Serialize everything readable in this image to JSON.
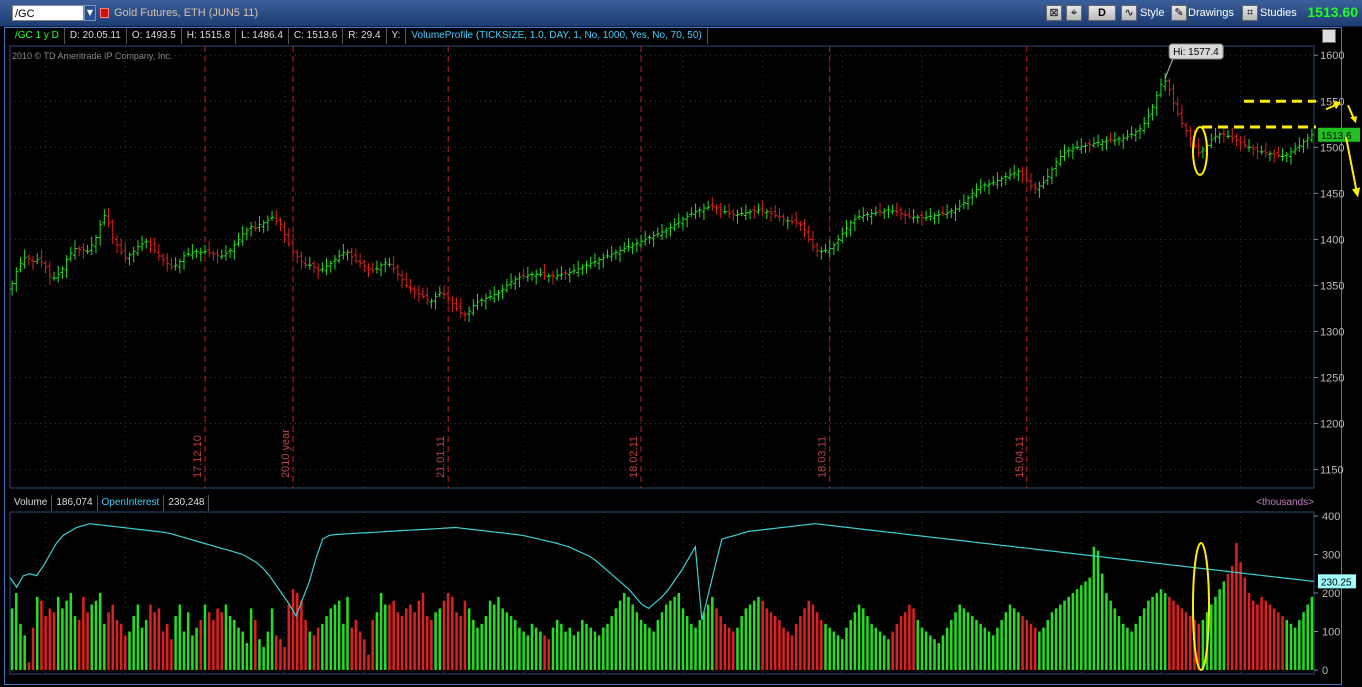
{
  "toolbar": {
    "symbol": "/GC",
    "description": "Gold Futures, ETH (JUN5 11)",
    "aggregation": "D",
    "style_label": "Style",
    "drawings_label": "Drawings",
    "studies_label": "Studies",
    "last_price": "1513.60"
  },
  "infobar": {
    "period": "/GC 1 y D",
    "date": "D: 20.05.11",
    "open": "O: 1493.5",
    "high": "H: 1515.8",
    "low": "L: 1486.4",
    "close": "C: 1513.6",
    "range": "R: 29.4",
    "y": "Y:",
    "study": "VolumeProfile (TICKSIZE, 1.0, DAY, 1, No, 1000, Yes, No, 70, 50)"
  },
  "copyright": "2010 © TD Ameritrade IP Company, Inc.",
  "volume_bar": {
    "volume_label": "Volume",
    "volume_value": "186,074",
    "oi_label": "OpenInterest",
    "oi_value": "230,248",
    "units": "<thousands>"
  },
  "colors": {
    "up": "#20e020",
    "down": "#e02020",
    "oi_line": "#40d0d0",
    "annotation": "#ffee00",
    "separator": "#c02020"
  },
  "chart_data": [
    {
      "type": "ohlc",
      "price_axis": {
        "ylim": [
          1130,
          1610
        ],
        "ticks": [
          1150,
          1200,
          1250,
          1300,
          1350,
          1400,
          1450,
          1500,
          1550,
          1600
        ]
      },
      "high_label": "Hi: 1577.4",
      "high_value": 1577.4,
      "current_label": "1513.6",
      "current_value": 1513.6,
      "annotation_levels": [
        1550,
        1522
      ],
      "separators": [
        {
          "label": "17.12.10",
          "index": 46
        },
        {
          "label": "2010 year",
          "index": 67
        },
        {
          "label": "21.01.11",
          "index": 104
        },
        {
          "label": "18.02.11",
          "index": 150
        },
        {
          "label": "18.03.11",
          "index": 195
        },
        {
          "label": "15.04.11",
          "index": 242
        }
      ],
      "closes": [
        1352,
        1365,
        1374,
        1380,
        1379,
        1376,
        1378,
        1375,
        1370,
        1360,
        1358,
        1362,
        1368,
        1378,
        1385,
        1390,
        1389,
        1388,
        1387,
        1394,
        1402,
        1416,
        1426,
        1418,
        1402,
        1394,
        1386,
        1380,
        1383,
        1387,
        1392,
        1395,
        1398,
        1394,
        1388,
        1382,
        1378,
        1374,
        1370,
        1372,
        1376,
        1382,
        1384,
        1386,
        1387,
        1386,
        1387,
        1386,
        1384,
        1383,
        1382,
        1385,
        1388,
        1394,
        1400,
        1406,
        1410,
        1414,
        1412,
        1416,
        1418,
        1421,
        1424,
        1420,
        1416,
        1405,
        1395,
        1387,
        1381,
        1376,
        1372,
        1372,
        1370,
        1366,
        1368,
        1371,
        1374,
        1378,
        1382,
        1386,
        1386,
        1381,
        1377,
        1374,
        1371,
        1368,
        1366,
        1368,
        1372,
        1375,
        1373,
        1368,
        1362,
        1356,
        1350,
        1346,
        1343,
        1341,
        1338,
        1334,
        1333,
        1338,
        1342,
        1340,
        1336,
        1330,
        1325,
        1320,
        1318,
        1322,
        1328,
        1332,
        1334,
        1336,
        1338,
        1340,
        1342,
        1346,
        1350,
        1354,
        1357,
        1359,
        1360,
        1361,
        1362,
        1362,
        1362,
        1361,
        1360,
        1360,
        1361,
        1362,
        1363,
        1364,
        1366,
        1368,
        1370,
        1372,
        1374,
        1376,
        1378,
        1380,
        1382,
        1384,
        1386,
        1388,
        1390,
        1392,
        1394,
        1396,
        1398,
        1400,
        1402,
        1404,
        1406,
        1408,
        1410,
        1413,
        1416,
        1419,
        1422,
        1425,
        1428,
        1430,
        1432,
        1434,
        1435,
        1436,
        1434,
        1432,
        1430,
        1428,
        1427,
        1427,
        1428,
        1429,
        1430,
        1431,
        1432,
        1431,
        1430,
        1428,
        1426,
        1424,
        1422,
        1420,
        1419,
        1418,
        1416,
        1410,
        1400,
        1392,
        1388,
        1387,
        1388,
        1390,
        1394,
        1400,
        1406,
        1412,
        1418,
        1422,
        1425,
        1426,
        1427,
        1428,
        1429,
        1430,
        1431,
        1432,
        1431,
        1430,
        1428,
        1426,
        1425,
        1424,
        1424,
        1424,
        1424,
        1425,
        1426,
        1427,
        1428,
        1429,
        1431,
        1433,
        1436,
        1440,
        1445,
        1450,
        1454,
        1457,
        1459,
        1460,
        1462,
        1464,
        1466,
        1468,
        1470,
        1472,
        1474,
        1470,
        1464,
        1458,
        1456,
        1458,
        1462,
        1468,
        1476,
        1484,
        1490,
        1494,
        1497,
        1499,
        1500,
        1501,
        1502,
        1503,
        1504,
        1505,
        1506,
        1507,
        1508,
        1508,
        1509,
        1510,
        1512,
        1514,
        1517,
        1520,
        1526,
        1534,
        1544,
        1556,
        1568,
        1572,
        1562,
        1548,
        1536,
        1526,
        1518,
        1510,
        1502,
        1494,
        1498,
        1502,
        1508,
        1512,
        1514,
        1514,
        1512,
        1510,
        1508,
        1505,
        1502,
        1500,
        1498,
        1496,
        1495,
        1494,
        1493,
        1492,
        1491,
        1490,
        1492,
        1495,
        1498,
        1502,
        1506,
        1510,
        1513.6
      ],
      "volume_axis": {
        "ylim": [
          0,
          400
        ],
        "ticks": [
          0,
          100,
          200,
          300,
          400
        ]
      },
      "oi_current_label": "230.25",
      "oi_current_value": 230.25,
      "volume": [
        160,
        200,
        120,
        90,
        20,
        110,
        190,
        180,
        140,
        160,
        150,
        190,
        160,
        180,
        200,
        140,
        130,
        190,
        150,
        170,
        180,
        200,
        120,
        150,
        170,
        130,
        120,
        90,
        100,
        140,
        170,
        110,
        130,
        170,
        150,
        160,
        100,
        120,
        80,
        140,
        170,
        100,
        150,
        90,
        110,
        130,
        170,
        150,
        130,
        160,
        150,
        170,
        140,
        130,
        110,
        100,
        70,
        160,
        130,
        80,
        60,
        100,
        160,
        90,
        80,
        60,
        170,
        210,
        200,
        180,
        130,
        100,
        90,
        110,
        120,
        140,
        160,
        170,
        180,
        120,
        190,
        110,
        130,
        100,
        80,
        40,
        130,
        150,
        200,
        170,
        170,
        180,
        150,
        140,
        160,
        170,
        150,
        180,
        200,
        140,
        130,
        150,
        160,
        180,
        200,
        190,
        150,
        140,
        180,
        160,
        130,
        110,
        120,
        140,
        180,
        170,
        190,
        160,
        150,
        140,
        130,
        110,
        100,
        90,
        120,
        110,
        100,
        90,
        80,
        110,
        130,
        120,
        100,
        110,
        90,
        100,
        130,
        120,
        110,
        100,
        90,
        110,
        120,
        140,
        160,
        180,
        200,
        190,
        170,
        150,
        130,
        120,
        110,
        100,
        130,
        150,
        170,
        180,
        190,
        200,
        160,
        140,
        120,
        110,
        130,
        150,
        170,
        190,
        160,
        140,
        120,
        110,
        100,
        110,
        140,
        160,
        170,
        180,
        190,
        180,
        160,
        150,
        140,
        130,
        110,
        100,
        90,
        120,
        140,
        160,
        180,
        170,
        150,
        130,
        120,
        110,
        100,
        90,
        80,
        110,
        130,
        150,
        170,
        160,
        140,
        120,
        110,
        100,
        90,
        80,
        100,
        120,
        140,
        150,
        170,
        160,
        130,
        110,
        100,
        90,
        80,
        70,
        90,
        110,
        130,
        150,
        170,
        160,
        150,
        140,
        130,
        120,
        110,
        100,
        90,
        110,
        130,
        150,
        170,
        160,
        150,
        140,
        130,
        120,
        110,
        100,
        110,
        130,
        150,
        160,
        170,
        180,
        190,
        200,
        210,
        220,
        230,
        240,
        320,
        310,
        250,
        200,
        180,
        160,
        140,
        120,
        110,
        100,
        120,
        140,
        160,
        180,
        190,
        200,
        210,
        200,
        190,
        180,
        170,
        160,
        150,
        140,
        130,
        120,
        130,
        150,
        170,
        190,
        210,
        230,
        250,
        270,
        330,
        280,
        240,
        200,
        180,
        170,
        190,
        180,
        170,
        160,
        150,
        140,
        130,
        120,
        110,
        130,
        150,
        170,
        190
      ],
      "open_interest": [
        240,
        215,
        245,
        250,
        245,
        270,
        300,
        330,
        350,
        360,
        370,
        375,
        380,
        378,
        376,
        374,
        372,
        370,
        368,
        366,
        364,
        362,
        360,
        358,
        355,
        350,
        345,
        340,
        335,
        330,
        325,
        320,
        315,
        310,
        305,
        300,
        290,
        280,
        265,
        245,
        220,
        195,
        170,
        140,
        185,
        230,
        290,
        340,
        350,
        352,
        353,
        354,
        355,
        356,
        357,
        358,
        359,
        360,
        361,
        362,
        363,
        364,
        365,
        366,
        367,
        368,
        369,
        370,
        368,
        366,
        364,
        362,
        360,
        358,
        356,
        354,
        352,
        350,
        346,
        342,
        338,
        334,
        330,
        325,
        320,
        312,
        304,
        296,
        285,
        270,
        255,
        240,
        225,
        210,
        190,
        170,
        160,
        175,
        190,
        210,
        235,
        260,
        290,
        320,
        130,
        200,
        270,
        340,
        345,
        350,
        355,
        360,
        362,
        364,
        366,
        368,
        370,
        372,
        374,
        376,
        378,
        380,
        378,
        376,
        374,
        372,
        370,
        368,
        366,
        364,
        362,
        360,
        358,
        356,
        354,
        352,
        350,
        348,
        346,
        344,
        342,
        340,
        338,
        336,
        334,
        332,
        330,
        328,
        326,
        324,
        322,
        320,
        318,
        316,
        314,
        312,
        310,
        308,
        306,
        304,
        302,
        300,
        298,
        296,
        294,
        292,
        290,
        288,
        286,
        284,
        282,
        280,
        278,
        276,
        274,
        272,
        270,
        268,
        266,
        264,
        262,
        260,
        258,
        256,
        254,
        252,
        250,
        248,
        246,
        244,
        242,
        240,
        238,
        236,
        234,
        232,
        230.25
      ]
    }
  ]
}
